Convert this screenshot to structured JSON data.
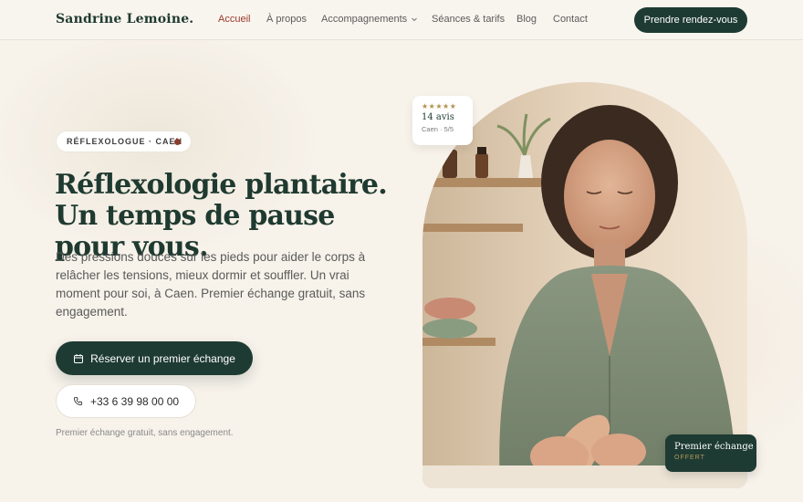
{
  "header": {
    "brand": "Sandrine Lemoine.",
    "nav": [
      {
        "label": "Accueil",
        "active": true
      },
      {
        "label": "À propos"
      },
      {
        "label": "Accompagnements",
        "has_dropdown": true
      },
      {
        "label": "Séances & tarifs"
      },
      {
        "label": "Blog"
      },
      {
        "label": "Contact"
      }
    ],
    "cta": "Prendre rendez-vous"
  },
  "hero": {
    "badge": "RÉFLEXOLOGUE · CAEN",
    "title": "Réflexologie plantaire. Un temps de pause pour vous.",
    "lead": "Des pressions douces sur les pieds pour aider le corps à relâcher les tensions, mieux dormir et souffler. Un vrai moment pour soi, à Caen. Premier échange gratuit, sans engagement.",
    "primary_button": "Réserver un premier échange",
    "phone_button": "+33 6 39 98 00 00",
    "note": "Premier échange gratuit, sans engagement."
  },
  "reviews_card": {
    "stars": "★★★★★",
    "count": "14 avis",
    "location": "Caen · 5/5"
  },
  "offer_card": {
    "title": "Premier échange",
    "subtitle": "OFFERT"
  },
  "colors": {
    "primary": "#1e3b33",
    "accent": "#9a3b2c",
    "background": "#f7f2ea",
    "gold": "#b4914d"
  }
}
